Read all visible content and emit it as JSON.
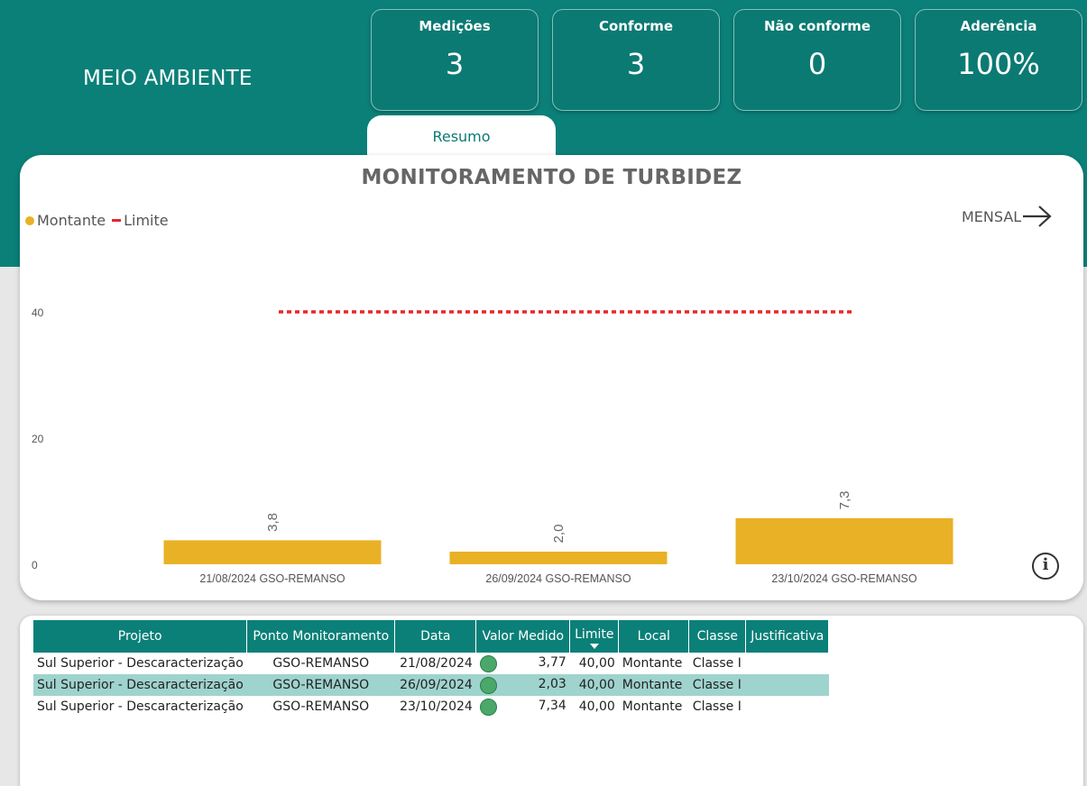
{
  "header": {
    "title": "MEIO AMBIENTE"
  },
  "kpis": [
    {
      "label": "Medições",
      "value": "3"
    },
    {
      "label": "Conforme",
      "value": "3"
    },
    {
      "label": "Não conforme",
      "value": "0"
    },
    {
      "label": "Aderência",
      "value": "100%"
    }
  ],
  "tabs": [
    {
      "label": "Resumo"
    }
  ],
  "chart": {
    "title": "MONITORAMENTO DE TURBIDEZ",
    "legend": [
      {
        "label": "Montante",
        "color": "#e9b125"
      },
      {
        "label": "Limite",
        "color": "#e8262a"
      }
    ],
    "mensal_label": "MENSAL",
    "info_icon": "info-icon"
  },
  "chart_data": {
    "type": "bar",
    "title": "MONITORAMENTO DE TURBIDEZ",
    "categories": [
      "21/08/2024 GSO-REMANSO",
      "26/09/2024 GSO-REMANSO",
      "23/10/2024 GSO-REMANSO"
    ],
    "series": [
      {
        "name": "Montante",
        "values": [
          3.8,
          2.0,
          7.3
        ],
        "labels": [
          "3,8",
          "2,0",
          "7,3"
        ],
        "color": "#e9b125"
      },
      {
        "name": "Limite",
        "values": [
          40,
          40,
          40
        ],
        "style": "dotted-line",
        "color": "#e8262a"
      }
    ],
    "yticks": [
      "0",
      "20",
      "40"
    ],
    "ylim": [
      0,
      45
    ],
    "legend_position": "top-left",
    "grid": false
  },
  "table": {
    "headers": [
      "Projeto",
      "Ponto Monitoramento",
      "Data",
      "Valor Medido",
      "Limite",
      "Local",
      "Classe",
      "Justificativa"
    ],
    "rows": [
      [
        "Sul Superior - Descaracterização",
        "GSO-REMANSO",
        "21/08/2024",
        "3,77",
        "40,00",
        "Montante",
        "Classe I",
        ""
      ],
      [
        "Sul Superior - Descaracterização",
        "GSO-REMANSO",
        "26/09/2024",
        "2,03",
        "40,00",
        "Montante",
        "Classe I",
        ""
      ],
      [
        "Sul Superior - Descaracterização",
        "GSO-REMANSO",
        "23/10/2024",
        "7,34",
        "40,00",
        "Montante",
        "Classe I",
        ""
      ]
    ],
    "highlighted_row": 1,
    "status_color": "#4aa86a"
  }
}
